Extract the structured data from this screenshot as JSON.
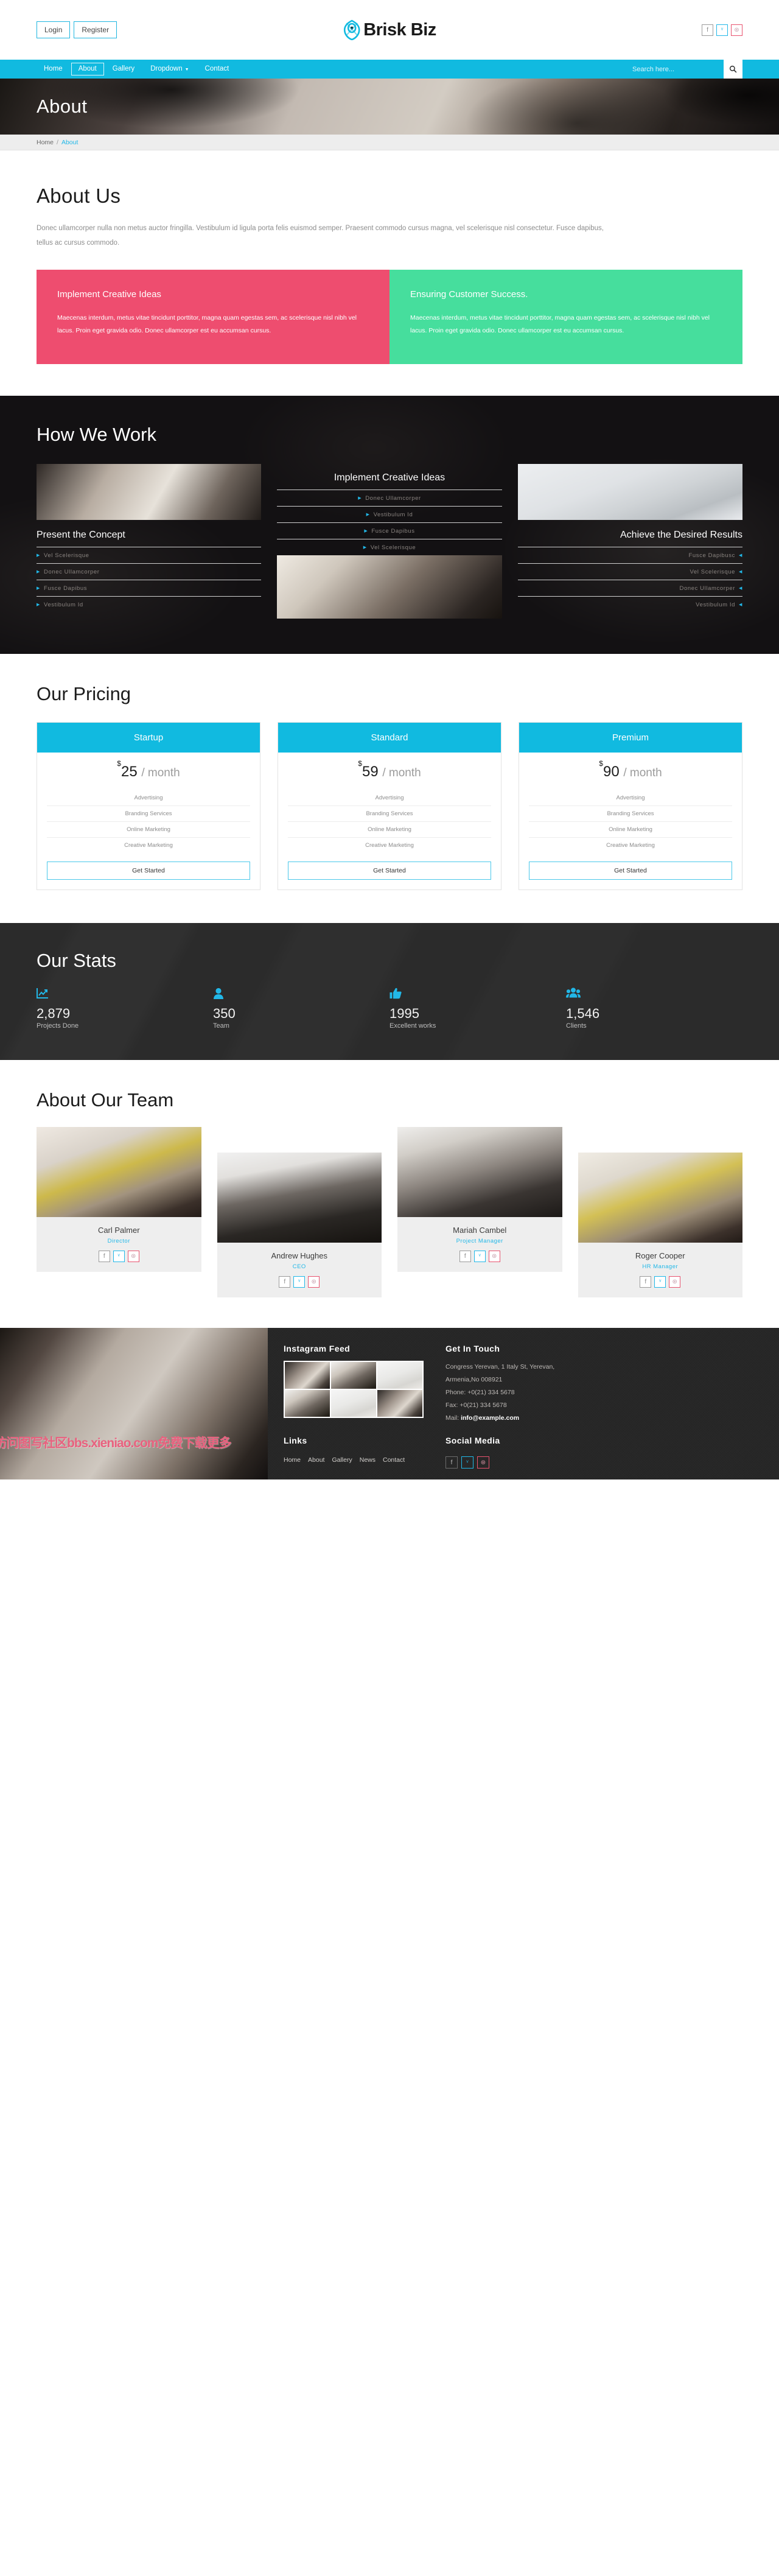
{
  "topbar": {
    "login_label": "Login",
    "register_label": "Register",
    "logo_text": "Brisk Biz",
    "social": [
      {
        "icon": "facebook-icon",
        "glyph": "f"
      },
      {
        "icon": "twitter-icon",
        "glyph": "ᵛ"
      },
      {
        "icon": "dribbble-icon",
        "glyph": "⊛"
      }
    ]
  },
  "nav": {
    "items": [
      {
        "label": "Home",
        "active": false,
        "has_caret": false
      },
      {
        "label": "About",
        "active": true,
        "has_caret": false
      },
      {
        "label": "Gallery",
        "active": false,
        "has_caret": false
      },
      {
        "label": "Dropdown",
        "active": false,
        "has_caret": true
      },
      {
        "label": "Contact",
        "active": false,
        "has_caret": false
      }
    ],
    "search_placeholder": "Search here...",
    "search_value": "",
    "search_icon": "search-icon"
  },
  "hero": {
    "title": "About"
  },
  "breadcrumb": {
    "home": "Home",
    "sep": "/",
    "current": "About"
  },
  "about": {
    "heading": "About Us",
    "paragraph": "Donec ullamcorper nulla non metus auctor fringilla. Vestibulum id ligula porta felis euismod semper. Praesent commodo cursus magna, vel scelerisque nisl consectetur. Fusce dapibus, tellus ac cursus commodo.",
    "cards": [
      {
        "title": "Implement Creative Ideas",
        "body": "Maecenas interdum, metus vitae tincidunt porttitor, magna quam egestas sem, ac scelerisque nisl nibh vel lacus. Proin eget gravida odio. Donec ullamcorper est eu accumsan cursus.",
        "color": "#ee4d6f"
      },
      {
        "title": "Ensuring Customer Success.",
        "body": "Maecenas interdum, metus vitae tincidunt porttitor, magna quam egestas sem, ac scelerisque nisl nibh vel lacus. Proin eget gravida odio. Donec ullamcorper est eu accumsan cursus.",
        "color": "#46de9d"
      }
    ]
  },
  "work": {
    "heading": "How We Work",
    "columns": [
      {
        "title": "Present the Concept",
        "items": [
          "Vel Scelerisque",
          "Donec Ullamcorper",
          "Fusce Dapibus",
          "Vestibulum Id"
        ]
      },
      {
        "title": "Implement Creative Ideas",
        "items": [
          "Donec Ullamcorper",
          "Vestibulum Id",
          "Fusce Dapibus",
          "Vel Scelerisque"
        ]
      },
      {
        "title": "Achieve the Desired Results",
        "items": [
          "Fusce Dapibusc",
          "Vel Scelerisque",
          "Donec Ullamcorper",
          "Vestibulum Id"
        ]
      }
    ]
  },
  "pricing": {
    "heading": "Our Pricing",
    "plans": [
      {
        "name": "Startup",
        "currency": "$",
        "price": "25",
        "period": "/ month",
        "features": [
          "Advertising",
          "Branding Services",
          "Online Marketing",
          "Creative Marketing"
        ],
        "cta": "Get Started"
      },
      {
        "name": "Standard",
        "currency": "$",
        "price": "59",
        "period": "/ month",
        "features": [
          "Advertising",
          "Branding Services",
          "Online Marketing",
          "Creative Marketing"
        ],
        "cta": "Get Started"
      },
      {
        "name": "Premium",
        "currency": "$",
        "price": "90",
        "period": "/ month",
        "features": [
          "Advertising",
          "Branding Services",
          "Online Marketing",
          "Creative Marketing"
        ],
        "cta": "Get Started"
      }
    ]
  },
  "stats": {
    "heading": "Our Stats",
    "items": [
      {
        "icon": "chart-line-icon",
        "number": "2,879",
        "label": "Projects Done"
      },
      {
        "icon": "user-icon",
        "number": "350",
        "label": "Team"
      },
      {
        "icon": "thumbs-up-icon",
        "number": "1995",
        "label": "Excellent works"
      },
      {
        "icon": "users-group-icon",
        "number": "1,546",
        "label": "Clients"
      }
    ]
  },
  "team": {
    "heading": "About Our Team",
    "members": [
      {
        "name": "Carl Palmer",
        "role": "Director"
      },
      {
        "name": "Andrew Hughes",
        "role": "CEO"
      },
      {
        "name": "Mariah Cambel",
        "role": "Project Manager"
      },
      {
        "name": "Roger Cooper",
        "role": "HR Manager"
      }
    ],
    "social": [
      {
        "icon": "facebook-icon",
        "glyph": "f"
      },
      {
        "icon": "twitter-icon",
        "glyph": "ᵛ"
      },
      {
        "icon": "dribbble-icon",
        "glyph": "⊛"
      }
    ]
  },
  "footer": {
    "watermark": "访问图写社区bbs.xieniao.com免费下载更多",
    "instagram_title": "Instagram Feed",
    "touch_title": "Get In Touch",
    "address_line1": "Congress Yerevan, 1 Italy St, Yerevan,",
    "address_line2": "Armenia,No 008921",
    "phone": "Phone: +0(21) 334 5678",
    "fax": "Fax: +0(21) 334 5678",
    "mail_label": "Mail: ",
    "mail_value": "info@example.com",
    "links_title": "Links",
    "links": [
      "Home",
      "About",
      "Gallery",
      "News",
      "Contact"
    ],
    "social_title": "Social Media",
    "social": [
      {
        "icon": "facebook-icon",
        "glyph": "f"
      },
      {
        "icon": "twitter-icon",
        "glyph": "ᵛ"
      },
      {
        "icon": "dribbble-icon",
        "glyph": "⊛"
      }
    ]
  },
  "theme": {
    "accent": "#11bae0",
    "pink": "#ee4d6f",
    "green": "#46de9d",
    "dark": "#131113",
    "stats_bg": "#2b2b2b"
  }
}
